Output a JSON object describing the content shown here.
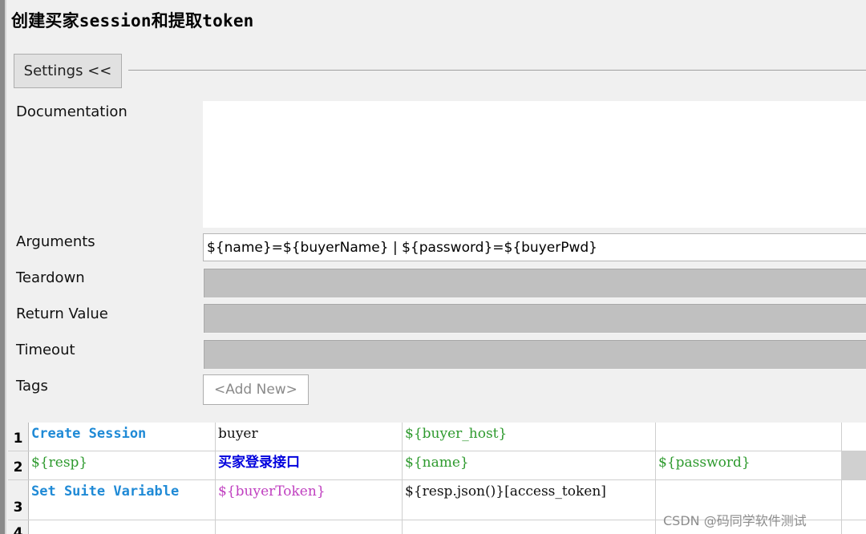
{
  "title": "创建买家session和提取token",
  "settings_button": "Settings <<",
  "labels": {
    "documentation": "Documentation",
    "arguments": "Arguments",
    "teardown": "Teardown",
    "return_value": "Return Value",
    "timeout": "Timeout",
    "tags": "Tags"
  },
  "arguments_value": "${name}=${buyerName} | ${password}=${buyerPwd}",
  "tags_add_new": "<Add New>",
  "rows": [
    {
      "num": "1",
      "cells": [
        "Create Session",
        "buyer",
        "${buyer_host}",
        ""
      ]
    },
    {
      "num": "2",
      "cells": [
        "${resp}",
        "买家登录接口",
        "${name}",
        "${password}"
      ]
    },
    {
      "num": "3",
      "cells": [
        "Set Suite Variable",
        "${buyerToken}",
        "${resp.json()}[access_token]",
        ""
      ]
    },
    {
      "num": "4",
      "cells": [
        "",
        "",
        "",
        ""
      ]
    }
  ],
  "watermark": "CSDN @码同学软件测试",
  "colors": {
    "keyword": "#1f8ad6",
    "variable": "#2e9a2e",
    "assign_variable": "#c040c0",
    "user_keyword": "#0000dd"
  }
}
